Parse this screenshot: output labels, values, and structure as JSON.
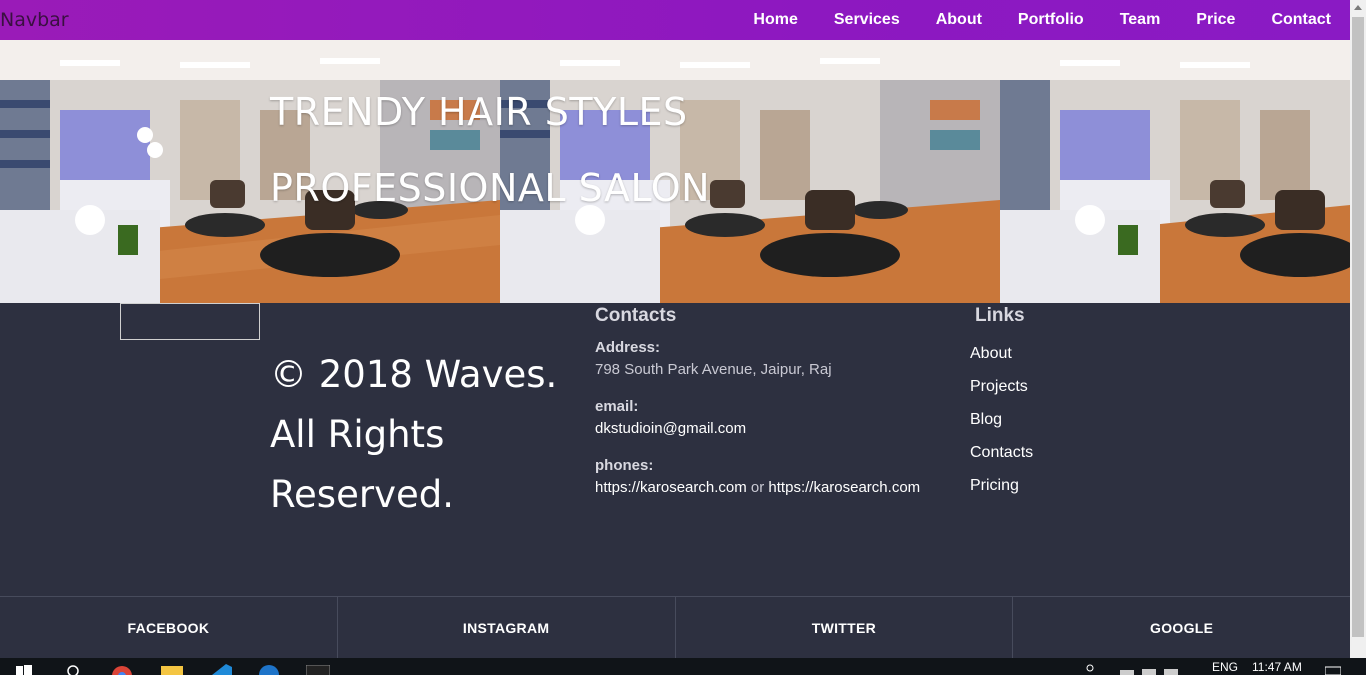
{
  "navbar": {
    "brand": "Navbar",
    "links": [
      "Home",
      "Services",
      "About",
      "Portfolio",
      "Team",
      "Price",
      "Contact"
    ]
  },
  "hero": {
    "line1": "TRENDY HAIR STYLES",
    "line2": "PROFESSIONAL SALON"
  },
  "footer": {
    "copyright": "© 2018 Waves. All Rights Reserved.",
    "contacts": {
      "heading": "Contacts",
      "address_label": "Address:",
      "address": "798 South Park Avenue, Jaipur, Raj",
      "email_label": "email:",
      "email": "dkstudioin@gmail.com",
      "phones_label": "phones:",
      "phone1": "https://karosearch.com",
      "phone_sep": "or",
      "phone2": "https://karosearch.com"
    },
    "links": {
      "heading": "Links",
      "items": [
        "About",
        "Projects",
        "Blog",
        "Contacts",
        "Pricing"
      ]
    }
  },
  "social": [
    "FACEBOOK",
    "INSTAGRAM",
    "TWITTER",
    "GOOGLE"
  ],
  "taskbar": {
    "language": "ENG",
    "time": "11:47 AM"
  },
  "colors": {
    "navbar": "#9a1bb8",
    "footer_bg": "#2d3040",
    "text": "#ffffff"
  }
}
